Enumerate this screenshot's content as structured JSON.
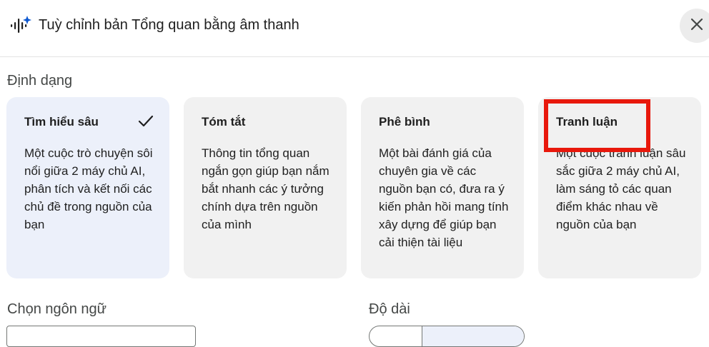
{
  "header": {
    "title": "Tuỳ chỉnh bản Tổng quan bằng âm thanh",
    "icon": "audio-sparkle-icon",
    "close_icon": "close-icon"
  },
  "format": {
    "label": "Định dạng",
    "cards": [
      {
        "title": "Tìm hiểu sâu",
        "selected": true,
        "description": "Một cuộc trò chuyện sôi nổi giữa 2 máy chủ AI, phân tích và kết nối các chủ đề trong nguồn của bạn"
      },
      {
        "title": "Tóm tắt",
        "selected": false,
        "description": "Thông tin tổng quan ngắn gọn giúp bạn nắm bắt nhanh các ý tưởng chính dựa trên nguồn của mình"
      },
      {
        "title": "Phê bình",
        "selected": false,
        "description": "Một bài đánh giá của chuyên gia về các nguồn bạn có, đưa ra ý kiến phản hồi mang tính xây dựng để giúp bạn cải thiện tài liệu"
      },
      {
        "title": "Tranh luận",
        "selected": false,
        "description": "Một cuộc tranh luận sâu sắc giữa 2 máy chủ AI, làm sáng tỏ các quan điểm khác nhau về nguồn của bạn"
      }
    ]
  },
  "language": {
    "label": "Chọn ngôn ngữ"
  },
  "length": {
    "label": "Độ dài"
  },
  "colors": {
    "selected_card": "#ecf0fa",
    "card": "#f1f1f1",
    "icon_blue": "#0b57d0",
    "highlight": "#e8180c"
  }
}
